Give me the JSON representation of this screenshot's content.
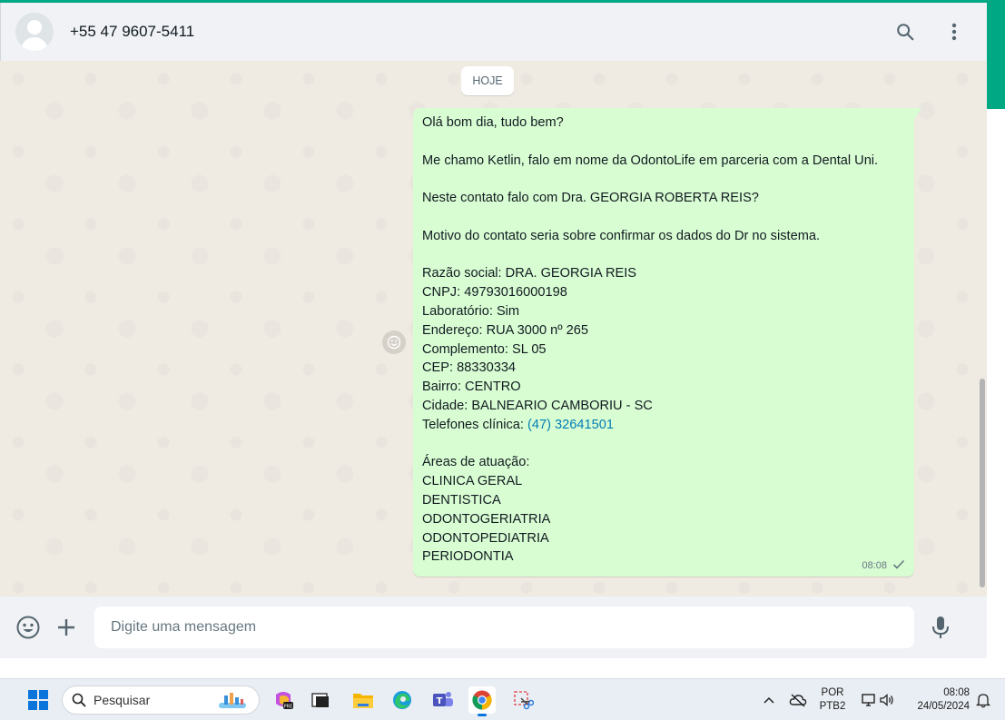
{
  "header": {
    "contact": "+55 47 9607-5411",
    "icons": [
      "search-icon",
      "menu-icon"
    ]
  },
  "chat": {
    "date_divider": "HOJE",
    "message": {
      "lines": [
        "Olá bom dia, tudo bem?",
        "",
        "Me chamo Ketlin, falo em nome da OdontoLife em parceria com a Dental Uni.",
        "",
        "Neste contato falo com Dra. GEORGIA ROBERTA REIS?",
        "",
        "Motivo do contato seria sobre confirmar os dados do Dr no sistema.",
        "",
        "Razão social: DRA. GEORGIA REIS",
        "CNPJ: 49793016000198",
        "Laboratório: Sim",
        "Endereço: RUA 3000 nº 265",
        "Complemento: SL 05",
        "CEP: 88330334",
        "Bairro: CENTRO",
        "Cidade: BALNEARIO CAMBORIU - SC"
      ],
      "phone_label": "Telefones clínica: ",
      "phone_link": "(47) 32641501",
      "areas_lines": [
        "Áreas de atuação:",
        "CLINICA GERAL",
        "DENTISTICA",
        "ODONTOGERIATRIA",
        "ODONTOPEDIATRIA",
        "PERIODONTIA"
      ],
      "time": "08:08",
      "status_icon": "single-check-icon"
    }
  },
  "composer": {
    "placeholder": "Digite uma mensagem",
    "icons": [
      "emoji-icon",
      "attach-plus-icon",
      "microphone-icon"
    ]
  },
  "taskbar": {
    "search_label": "Pesquisar",
    "lang_top": "POR",
    "lang_bottom": "PTB2",
    "time": "08:08",
    "date": "24/05/2024"
  },
  "colors": {
    "accent": "#00a884",
    "bubble": "#d9fdd3",
    "link": "#027eb5",
    "chat_bg": "#efeae2"
  }
}
